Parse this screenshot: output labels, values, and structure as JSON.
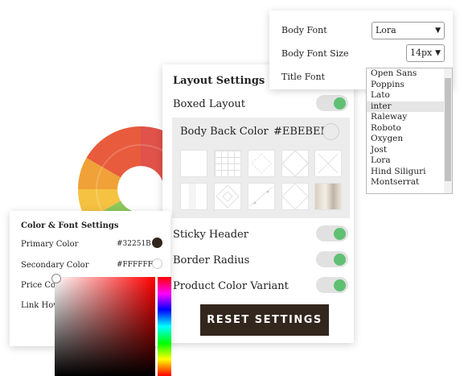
{
  "font_panel": {
    "body_font_label": "Body Font",
    "body_font_value": "Lora",
    "body_font_size_label": "Body Font Size",
    "body_font_size_value": "14px",
    "title_font_label": "Title Font",
    "font_options": [
      "Open Sans",
      "Poppins",
      "Lato",
      "inter",
      "Raleway",
      "Roboto",
      "Oxygen",
      "Jost",
      "Lora",
      "Hind Siliguri",
      "Montserrat"
    ],
    "selected_option": "inter"
  },
  "layout_settings": {
    "title": "Layout Settings",
    "boxed_layout_label": "Boxed Layout",
    "body_back_color_label": "Body Back Color",
    "body_back_color_value": "#EBEBEB",
    "sticky_header_label": "Sticky Header",
    "border_radius_label": "Border Radius",
    "product_color_variant_label": "Product Color Variant",
    "reset_button_label": "RESET SETTINGS",
    "toggle_on_color": "#5fc072",
    "button_color": "#33261d"
  },
  "color_font_settings": {
    "title": "Color & Font Settings",
    "primary_color_label": "Primary Color",
    "primary_color_value": "#32251B",
    "secondary_color_label": "Secondary Color",
    "secondary_color_value": "#FFFFFF",
    "price_color_label": "Price Col",
    "link_hover_label": "Link Hov"
  }
}
